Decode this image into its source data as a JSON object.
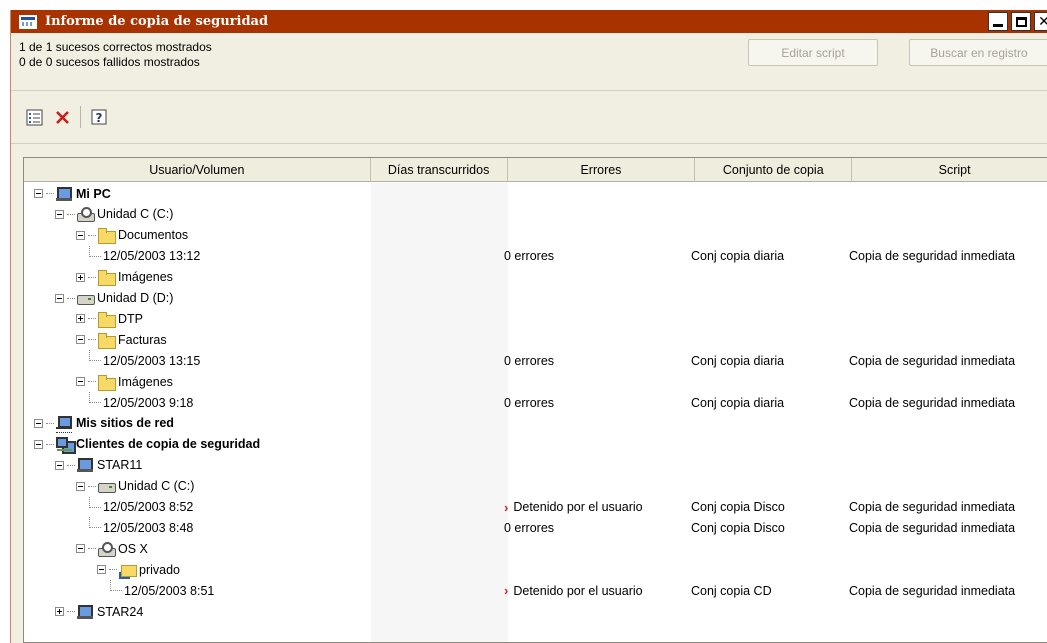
{
  "window": {
    "title": "Informe de copia de seguridad"
  },
  "status": {
    "success_line": "1 de 1 sucesos correctos mostrados",
    "fail_line": "0 de 0 sucesos fallidos mostrados"
  },
  "buttons": {
    "edit_script": "Editar script",
    "search_log": "Buscar en registro"
  },
  "toolbar": {
    "icons": [
      "properties-icon",
      "delete-icon",
      "help-icon"
    ]
  },
  "columns": [
    "Usuario/Volumen",
    "Días transcurridos",
    "Errores",
    "Conjunto de copia",
    "Script"
  ],
  "rows": [
    {
      "label": "Mi PC",
      "bold": true,
      "icon": "pc",
      "toggle": "minus",
      "errors": "",
      "set": "",
      "script": ""
    },
    {
      "label": "Unidad C (C:)",
      "bold": false,
      "icon": "netdrive",
      "toggle": "minus",
      "errors": "",
      "set": "",
      "script": ""
    },
    {
      "label": "Documentos",
      "bold": false,
      "icon": "folder",
      "toggle": "minus",
      "errors": "",
      "set": "",
      "script": ""
    },
    {
      "label": "12/05/2003 13:12",
      "bold": false,
      "icon": "",
      "toggle": "",
      "errors": "0 errores",
      "set": "Conj copia diaria",
      "script": "Copia de seguridad inmediata"
    },
    {
      "label": "Imágenes",
      "bold": false,
      "icon": "folder",
      "toggle": "plus",
      "errors": "",
      "set": "",
      "script": ""
    },
    {
      "label": "Unidad D (D:)",
      "bold": false,
      "icon": "drive",
      "toggle": "minus",
      "errors": "",
      "set": "",
      "script": ""
    },
    {
      "label": "DTP",
      "bold": false,
      "icon": "folder",
      "toggle": "plus",
      "errors": "",
      "set": "",
      "script": ""
    },
    {
      "label": "Facturas",
      "bold": false,
      "icon": "folder",
      "toggle": "minus",
      "errors": "",
      "set": "",
      "script": ""
    },
    {
      "label": "12/05/2003 13:15",
      "bold": false,
      "icon": "",
      "toggle": "",
      "errors": "0 errores",
      "set": "Conj copia diaria",
      "script": "Copia de seguridad inmediata"
    },
    {
      "label": "Imágenes",
      "bold": false,
      "icon": "folder",
      "toggle": "minus",
      "errors": "",
      "set": "",
      "script": ""
    },
    {
      "label": "12/05/2003 9:18",
      "bold": false,
      "icon": "",
      "toggle": "",
      "errors": "0 errores",
      "set": "Conj copia diaria",
      "script": "Copia de seguridad inmediata"
    },
    {
      "label": "Mis sitios de red",
      "bold": true,
      "icon": "net",
      "toggle": "minus",
      "errors": "",
      "set": "",
      "script": ""
    },
    {
      "label": "Clientes de copia de seguridad",
      "bold": true,
      "icon": "clients",
      "toggle": "minus",
      "errors": "",
      "set": "",
      "script": ""
    },
    {
      "label": "STAR11",
      "bold": false,
      "icon": "pc",
      "toggle": "minus",
      "errors": "",
      "set": "",
      "script": ""
    },
    {
      "label": "Unidad C (C:)",
      "bold": false,
      "icon": "drive",
      "toggle": "minus",
      "errors": "",
      "set": "",
      "script": ""
    },
    {
      "label": "12/05/2003 8:52",
      "bold": false,
      "icon": "",
      "toggle": "",
      "errors": "Detenido por el usuario",
      "error_flag": true,
      "set": "Conj copia Disco",
      "script": "Copia de seguridad inmediata"
    },
    {
      "label": "12/05/2003 8:48",
      "bold": false,
      "icon": "",
      "toggle": "",
      "errors": "0 errores",
      "set": "Conj copia Disco",
      "script": "Copia de seguridad inmediata"
    },
    {
      "label": "OS X",
      "bold": false,
      "icon": "netdrive",
      "toggle": "minus",
      "errors": "",
      "set": "",
      "script": ""
    },
    {
      "label": "privado",
      "bold": false,
      "icon": "shared",
      "toggle": "minus",
      "errors": "",
      "set": "",
      "script": ""
    },
    {
      "label": "12/05/2003 8:51",
      "bold": false,
      "icon": "",
      "toggle": "",
      "errors": "Detenido por el usuario",
      "error_flag": true,
      "set": "Conj copia CD",
      "script": "Copia de seguridad inmediata"
    },
    {
      "label": "STAR24",
      "bold": false,
      "icon": "pc",
      "toggle": "plus",
      "errors": "",
      "set": "",
      "script": ""
    }
  ]
}
